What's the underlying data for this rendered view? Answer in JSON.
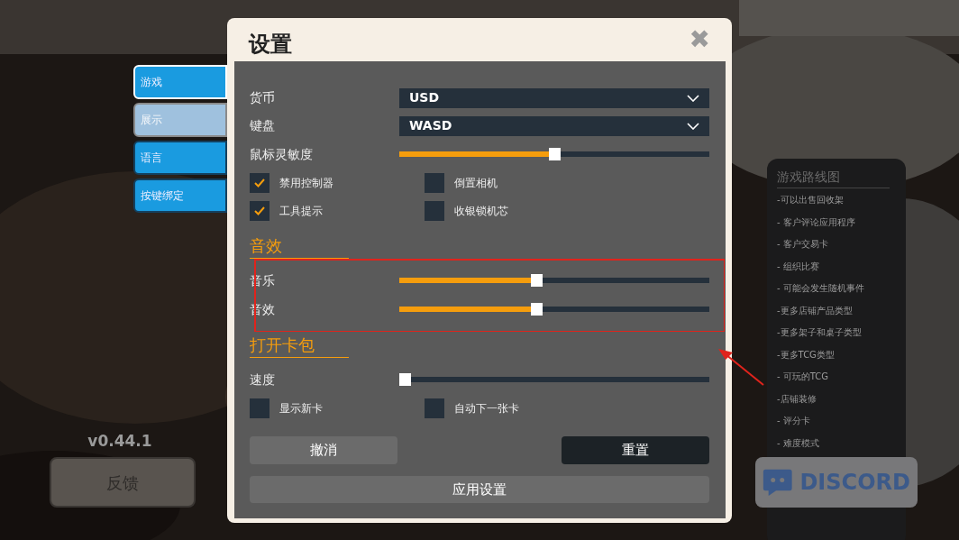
{
  "side_tabs": [
    {
      "label": "游戏",
      "selected": true,
      "hovered": false
    },
    {
      "label": "展示",
      "selected": false,
      "hovered": true
    },
    {
      "label": "语言",
      "selected": false,
      "hovered": false
    },
    {
      "label": "按键绑定",
      "selected": false,
      "hovered": false
    }
  ],
  "version": "v0.44.1",
  "feedback_button": "反馈",
  "dialog": {
    "title": "设置",
    "close": "✖",
    "rows": [
      {
        "kind": "dropdown",
        "label": "货币",
        "value": "USD"
      },
      {
        "kind": "dropdown",
        "label": "键盘",
        "value": "WASD"
      },
      {
        "kind": "slider",
        "label": "鼠标灵敏度",
        "level": 0.5
      },
      {
        "kind": "checks",
        "items": [
          {
            "label": "禁用控制器",
            "checked": true
          },
          {
            "label": "倒置相机",
            "checked": false
          }
        ]
      },
      {
        "kind": "checks",
        "items": [
          {
            "label": "工具提示",
            "checked": true
          },
          {
            "label": "收银锁机芯",
            "checked": false
          }
        ]
      },
      {
        "kind": "section",
        "label": "音效"
      },
      {
        "kind": "slider",
        "label": "音乐",
        "level": 0.44
      },
      {
        "kind": "slider",
        "label": "音效",
        "level": 0.44
      },
      {
        "kind": "section",
        "label": "打开卡包"
      },
      {
        "kind": "slider",
        "label": "速度",
        "level": 0
      },
      {
        "kind": "checks",
        "items": [
          {
            "label": "显示新卡",
            "checked": false
          },
          {
            "label": "自动下一张卡",
            "checked": false
          }
        ]
      }
    ],
    "buttons": [
      "撤消",
      "重置"
    ],
    "apply_button": "应用设置"
  },
  "roadmap": {
    "title": "游戏路线图",
    "items": [
      "-可以出售回收架",
      "- 客户评论应用程序",
      "- 客户交易卡",
      "- 组织比赛",
      "- 可能会发生随机事件",
      "-更多店铺产品类型",
      "-更多架子和桌子类型",
      "-更多TCG类型",
      "- 可玩的TCG",
      "-店铺装修",
      "- 评分卡",
      "- 难度模式"
    ]
  },
  "discord": "DISCORD"
}
